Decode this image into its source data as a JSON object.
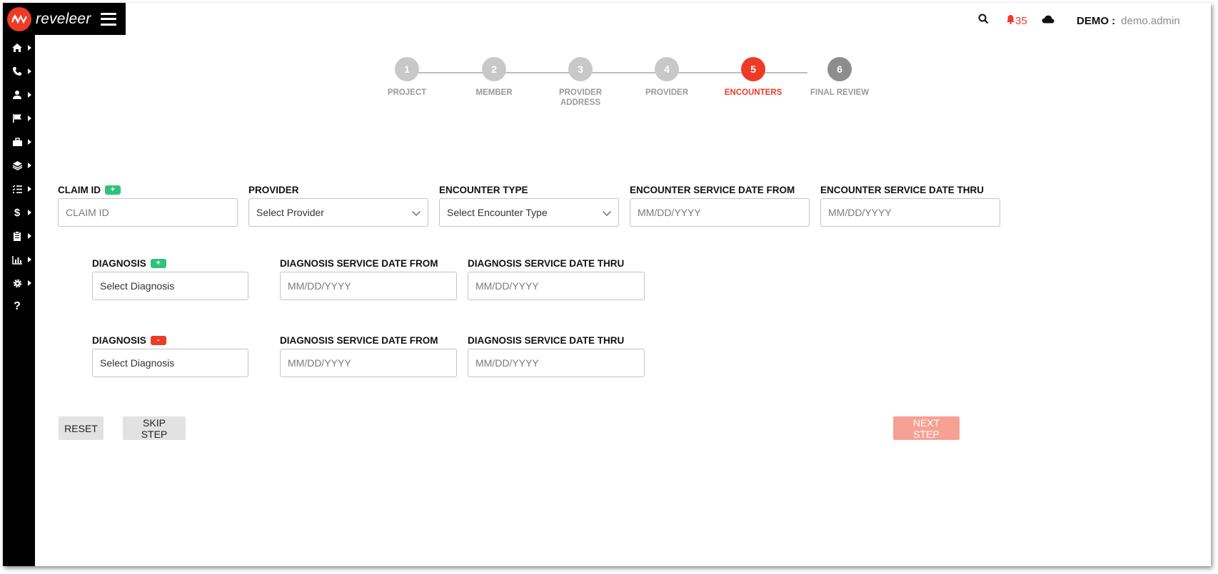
{
  "brand": {
    "name": "reveleer",
    "accent": "#ee3b28"
  },
  "header": {
    "notification_count": "35",
    "org_label": "DEMO :",
    "username": "demo.admin"
  },
  "sidebar": {
    "items": [
      {
        "icon": "home-icon"
      },
      {
        "icon": "phone-icon"
      },
      {
        "icon": "user-icon"
      },
      {
        "icon": "flag-icon"
      },
      {
        "icon": "briefcase-icon"
      },
      {
        "icon": "layers-icon"
      },
      {
        "icon": "checklist-icon"
      },
      {
        "icon": "dollar-icon"
      },
      {
        "icon": "clipboard-icon"
      },
      {
        "icon": "bar-chart-icon"
      },
      {
        "icon": "gear-icon"
      },
      {
        "icon": "help-icon"
      }
    ]
  },
  "stepper": {
    "steps": [
      {
        "number": "1",
        "label": "PROJECT"
      },
      {
        "number": "2",
        "label": "MEMBER"
      },
      {
        "number": "3",
        "label": "PROVIDER ADDRESS"
      },
      {
        "number": "4",
        "label": "PROVIDER"
      },
      {
        "number": "5",
        "label": "ENCOUNTERS"
      },
      {
        "number": "6",
        "label": "FINAL REVIEW"
      }
    ],
    "active_step": "5"
  },
  "encounter": {
    "claim_id": {
      "label": "CLAIM ID",
      "placeholder": "CLAIM ID",
      "badge": "+"
    },
    "provider": {
      "label": "PROVIDER",
      "value": "Select Provider"
    },
    "encounter_type": {
      "label": "ENCOUNTER TYPE",
      "value": "Select Encounter Type"
    },
    "service_date_from": {
      "label": "ENCOUNTER SERVICE DATE FROM",
      "placeholder": "MM/DD/YYYY"
    },
    "service_date_thru": {
      "label": "ENCOUNTER SERVICE DATE THRU",
      "placeholder": "MM/DD/YYYY"
    }
  },
  "diagnoses": [
    {
      "label": "DIAGNOSIS",
      "badge": "+",
      "value": "Select Diagnosis",
      "date_from_label": "DIAGNOSIS SERVICE DATE FROM",
      "date_from_placeholder": "MM/DD/YYYY",
      "date_thru_label": "DIAGNOSIS SERVICE DATE THRU",
      "date_thru_placeholder": "MM/DD/YYYY"
    },
    {
      "label": "DIAGNOSIS",
      "badge": "-",
      "value": "Select Diagnosis",
      "date_from_label": "DIAGNOSIS SERVICE DATE FROM",
      "date_from_placeholder": "MM/DD/YYYY",
      "date_thru_label": "DIAGNOSIS SERVICE DATE THRU",
      "date_thru_placeholder": "MM/DD/YYYY"
    }
  ],
  "buttons": {
    "reset": "RESET",
    "skip_step": "SKIP STEP",
    "next_step": "NEXT STEP"
  },
  "colors": {
    "accent": "#ee3b28",
    "add_badge": "#2fc27c",
    "step_inactive": "#c8c8c8",
    "step_final": "#8d8d8d",
    "next_button": "#f7a195"
  }
}
